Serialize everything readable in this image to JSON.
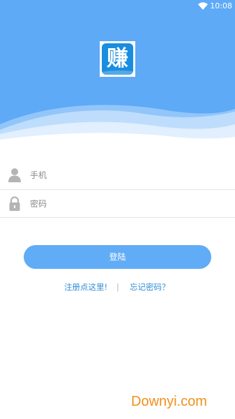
{
  "status_bar": {
    "time": "10:08"
  },
  "header": {
    "logo_char": "赚",
    "colors": {
      "background": "#5eaaf7",
      "logo": "#1a8de0"
    }
  },
  "form": {
    "phone": {
      "icon": "user-icon",
      "placeholder": "手机",
      "value": ""
    },
    "password": {
      "icon": "lock-icon",
      "placeholder": "密码",
      "value": ""
    }
  },
  "login_button": {
    "label": "登陆",
    "color": "#61acf6"
  },
  "links": {
    "register": "注册点这里!",
    "separator": "|",
    "forgot": "忘记密码？",
    "color": "#2f8fd8"
  },
  "watermark": {
    "text": "Downyi.com",
    "color": "#f0901a"
  }
}
